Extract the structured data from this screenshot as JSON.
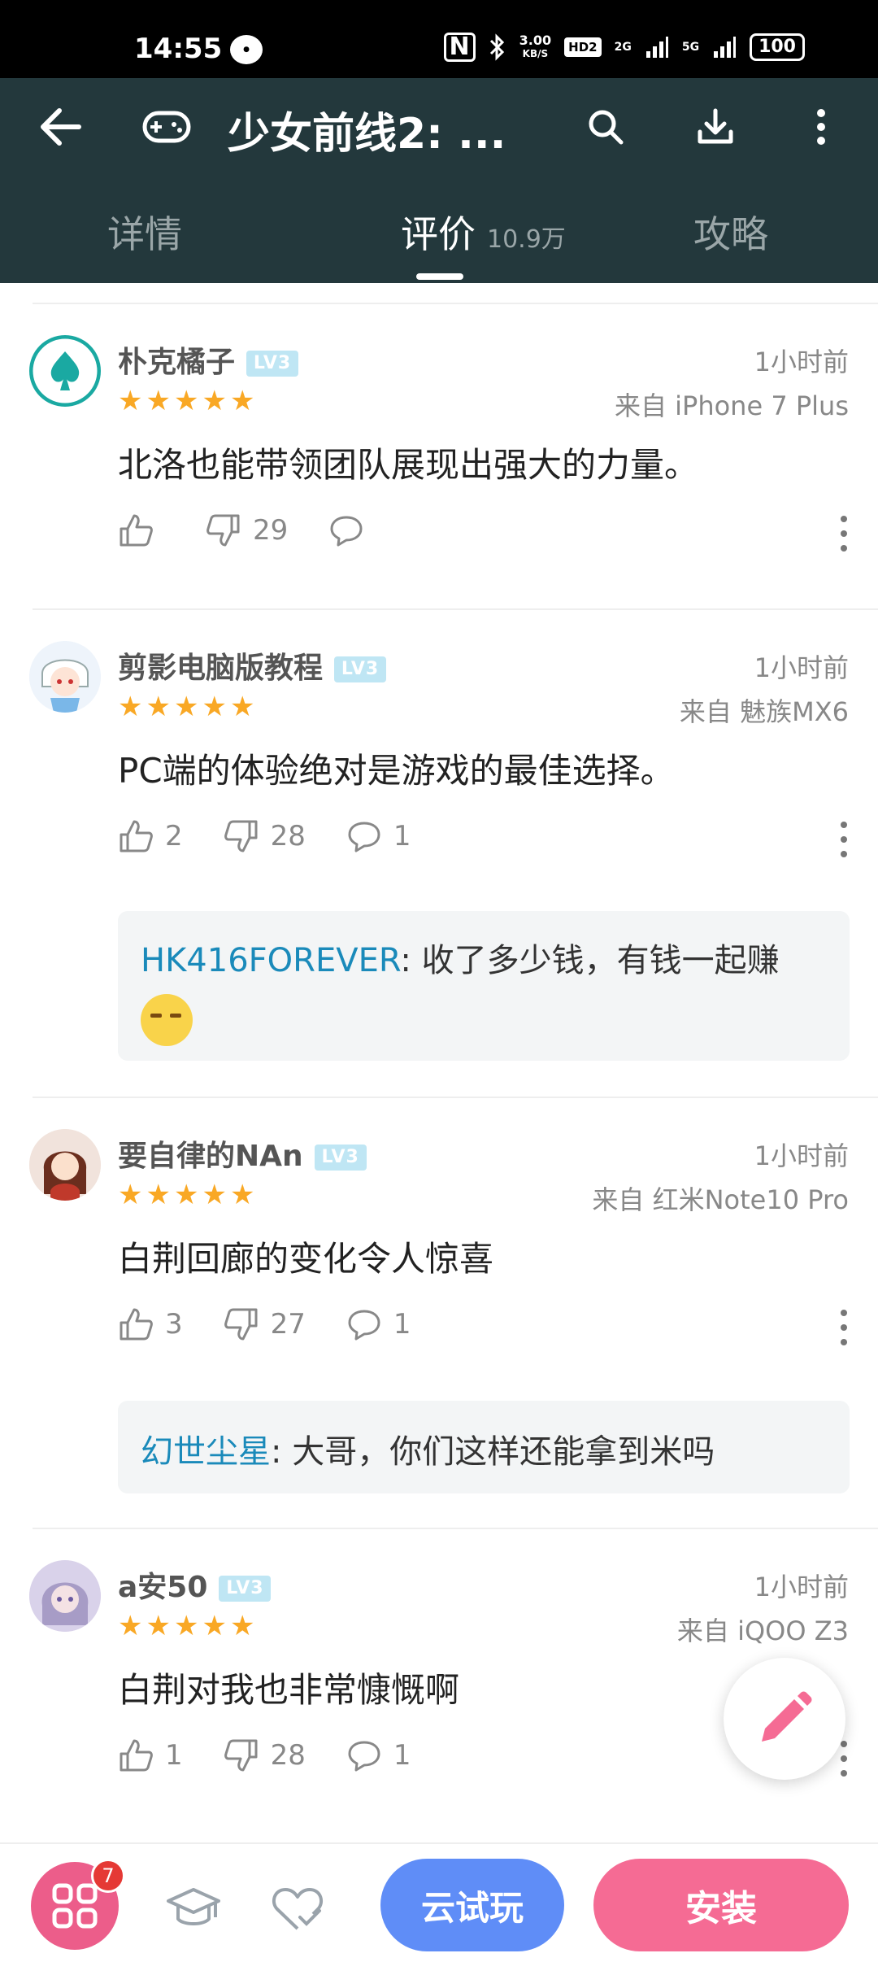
{
  "status_bar": {
    "time": "14:55",
    "net_speed_value": "3.00",
    "net_speed_unit": "KB/S",
    "hd_badge": "HD2",
    "signal_1": "2G",
    "signal_2": "5G",
    "battery": "100"
  },
  "header": {
    "title": "少女前线2: ..."
  },
  "tabs": [
    {
      "label": "详情"
    },
    {
      "label": "评价",
      "count": "10.9万"
    },
    {
      "label": "攻略"
    }
  ],
  "reviews": [
    {
      "username": "朴克橘子",
      "level": "LV3",
      "time": "1小时前",
      "rating": 5,
      "device": "来自 iPhone 7 Plus",
      "content": "北洛也能带领团队展现出强大的力量。",
      "likes": "",
      "dislikes": "29",
      "comments": ""
    },
    {
      "username": "剪影电脑版教程",
      "level": "LV3",
      "time": "1小时前",
      "rating": 5,
      "device": "来自 魅族MX6",
      "content": "PC端的体验绝对是游戏的最佳选择。",
      "likes": "2",
      "dislikes": "28",
      "comments": "1",
      "reply": {
        "user": "HK416FOREVER",
        "text": ": 收了多少钱，有钱一起赚"
      }
    },
    {
      "username": "要自律的NAn",
      "level": "LV3",
      "time": "1小时前",
      "rating": 5,
      "device": "来自 红米Note10 Pro",
      "content": "白荆回廊的变化令人惊喜",
      "likes": "3",
      "dislikes": "27",
      "comments": "1",
      "reply": {
        "user": "幻世尘星",
        "text": ": 大哥，你们这样还能拿到米吗"
      }
    },
    {
      "username": "a安50",
      "level": "LV3",
      "time": "1小时前",
      "rating": 5,
      "device": "来自 iQOO Z3",
      "content": "白荆对我也非常慷慨啊",
      "likes": "1",
      "dislikes": "28",
      "comments": "1"
    }
  ],
  "bottom_bar": {
    "apps_badge": "7",
    "cloud_play": "云试玩",
    "install": "安装"
  },
  "colors": {
    "header_bg": "#23383c",
    "accent_pink": "#f56b94",
    "accent_blue": "#5f8df7",
    "star": "#f9a825",
    "reply_user": "#1a8aba"
  }
}
